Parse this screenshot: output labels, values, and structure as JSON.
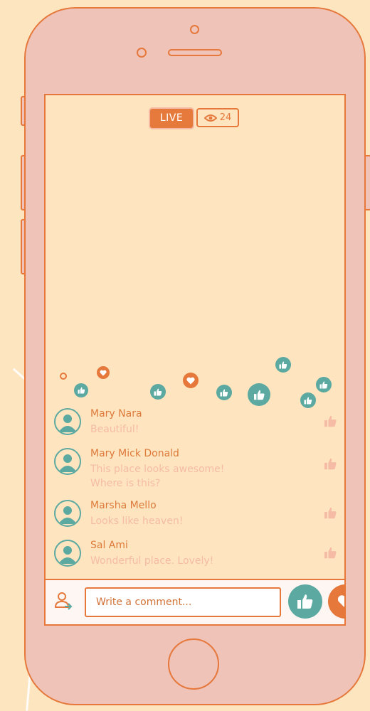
{
  "stream": {
    "live_label": "LIVE",
    "viewer_count": "24"
  },
  "comments": [
    {
      "author": "Mary Nara",
      "lines": [
        "Beautiful!"
      ]
    },
    {
      "author": "Mary Mick Donald",
      "lines": [
        "This place looks awesome!",
        "Where is this?"
      ]
    },
    {
      "author": "Marsha Mello",
      "lines": [
        "Looks like heaven!"
      ]
    },
    {
      "author": "Sal Ami",
      "lines": [
        "Wonderful place. Lovely!"
      ]
    }
  ],
  "comment_bar": {
    "placeholder": "Write a comment..."
  },
  "icons": {
    "like": "thumbs-up-icon",
    "heart": "heart-icon",
    "viewers": "eye-icon",
    "user": "add-user-icon"
  },
  "colors": {
    "accent_orange": "#e5783a",
    "teal": "#5ba9a1",
    "screen_bg": "#fee5bf",
    "phone_body": "#f0c3b9",
    "page_bg": "#fde5c0",
    "comment_text": "#f5bba5"
  }
}
